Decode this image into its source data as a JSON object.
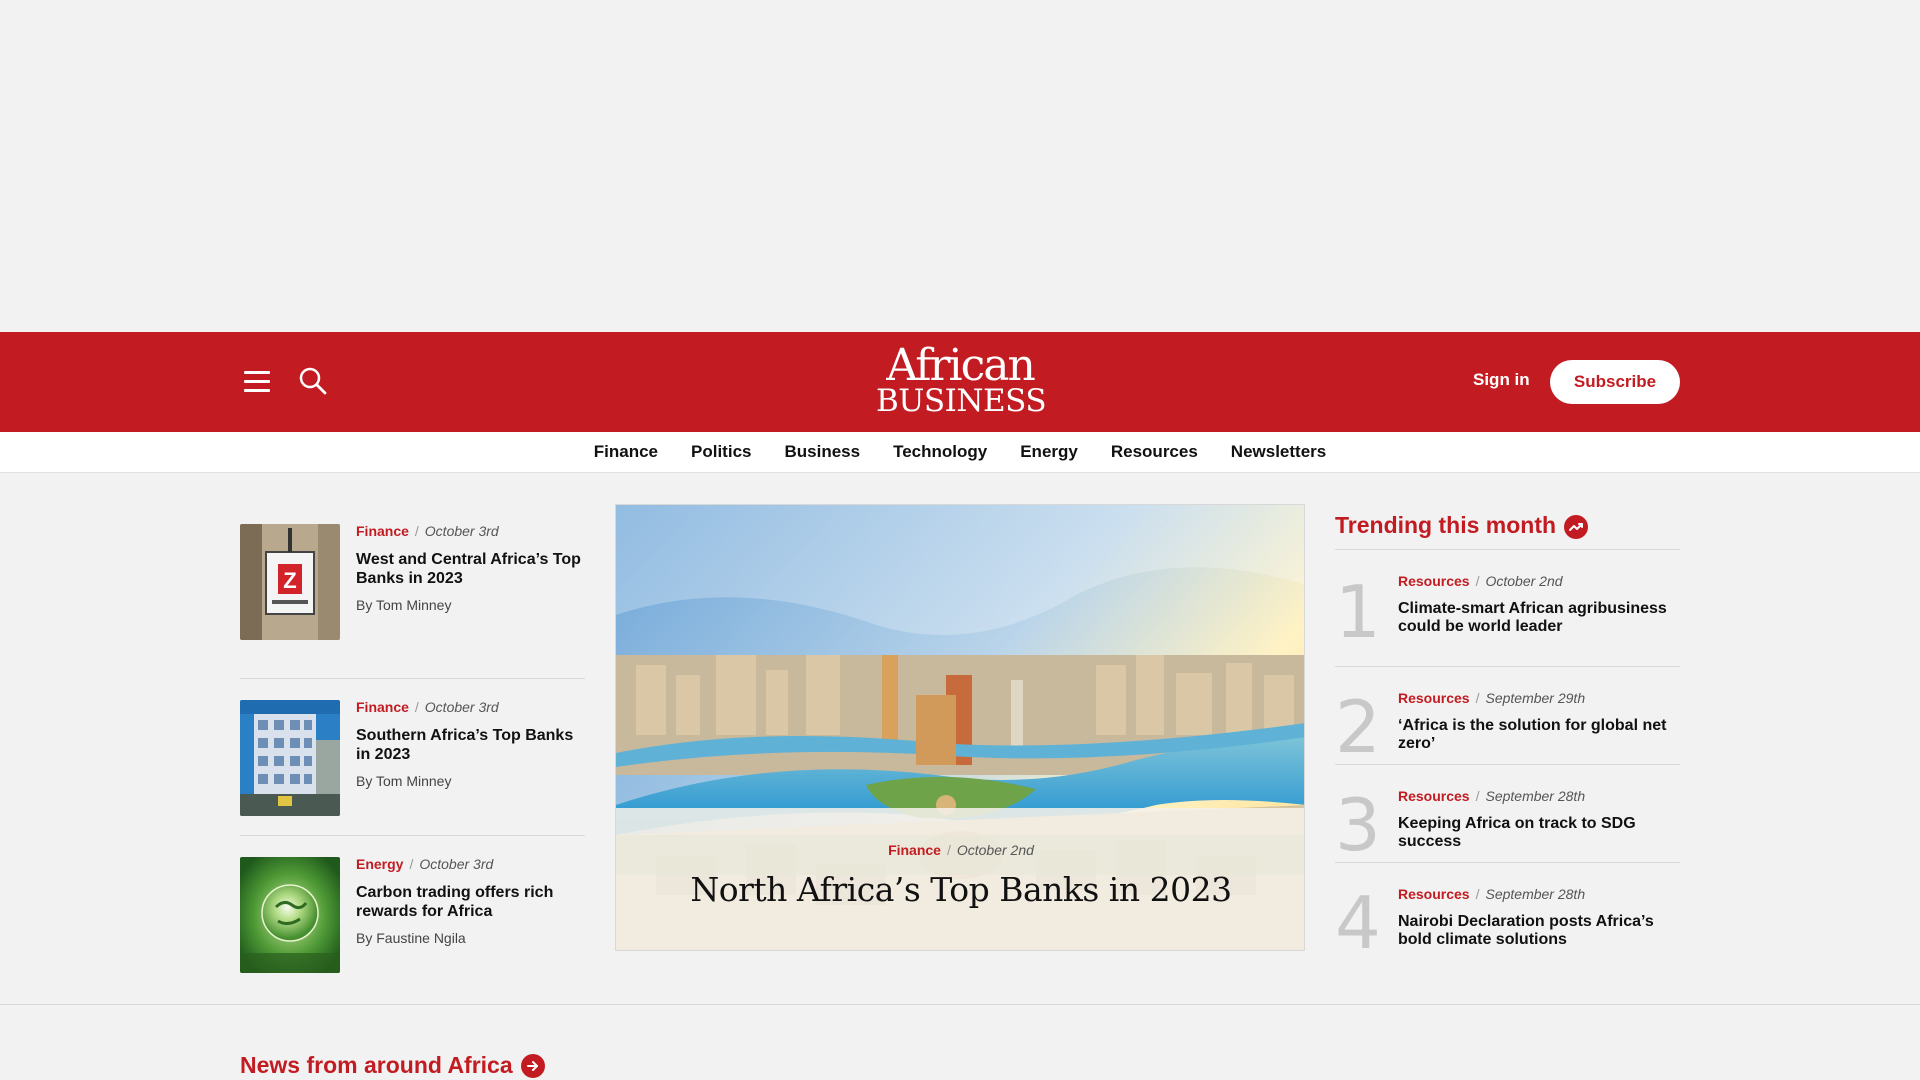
{
  "header": {
    "logo_top": "African",
    "logo_bottom": "BUSINESS",
    "signin_label": "Sign in",
    "subscribe_label": "Subscribe",
    "brand_color": "#c21c22"
  },
  "nav": {
    "items": [
      "Finance",
      "Politics",
      "Business",
      "Technology",
      "Energy",
      "Resources",
      "Newsletters"
    ]
  },
  "left_cards": [
    {
      "category": "Finance",
      "date": "October 3rd",
      "title": "West and Central Africa’s Top Banks in 2023",
      "byline": "By Tom Minney"
    },
    {
      "category": "Finance",
      "date": "October 3rd",
      "title": "Southern Africa’s Top Banks in 2023",
      "byline": "By Tom Minney"
    },
    {
      "category": "Energy",
      "date": "October 3rd",
      "title": "Carbon trading offers rich rewards for Africa",
      "byline": "By Faustine Ngila"
    }
  ],
  "feature": {
    "category": "Finance",
    "date": "October 2nd",
    "title": "North Africa’s Top Banks in 2023"
  },
  "trending": {
    "heading": "Trending this month",
    "items": [
      {
        "rank": "1",
        "category": "Resources",
        "date": "October 2nd",
        "title": "Climate-smart African agribusiness could be world leader"
      },
      {
        "rank": "2",
        "category": "Resources",
        "date": "September 29th",
        "title": "‘Africa is the solution for global net zero’"
      },
      {
        "rank": "3",
        "category": "Resources",
        "date": "September 28th",
        "title": "Keeping Africa on track to SDG success"
      },
      {
        "rank": "4",
        "category": "Resources",
        "date": "September 28th",
        "title": "Nairobi Declaration posts Africa’s bold climate solutions"
      }
    ]
  },
  "news_section": {
    "heading": "News from around Africa"
  },
  "icons": {
    "menu": "hamburger-menu-icon",
    "search": "search-icon",
    "trending": "trending-up-icon",
    "arrow": "arrow-right-icon"
  }
}
